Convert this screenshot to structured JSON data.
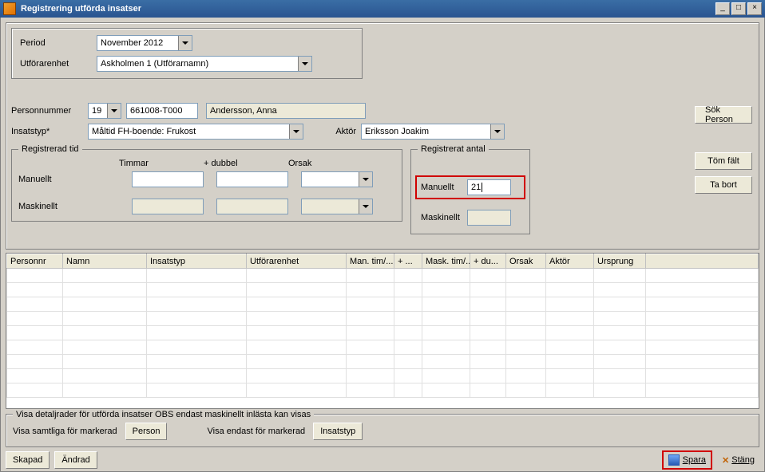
{
  "window": {
    "title": "Registrering utförda insatser"
  },
  "labels": {
    "period": "Period",
    "utforarenhet": "Utförarenhet",
    "personnummer": "Personnummer",
    "insatstyp": "Insatstyp*",
    "aktor": "Aktör",
    "timmar": "Timmar",
    "plus_dubbel": "+ dubbel",
    "orsak": "Orsak",
    "manuellt": "Manuellt",
    "maskinellt": "Maskinellt",
    "reg_tid": "Registrerad tid",
    "reg_antal": "Registrerat antal",
    "visa_samtliga": "Visa samtliga för markerad",
    "visa_endast": "Visa endast för markerad",
    "detail_legend": "Visa detaljrader för utförda insatser OBS endast maskinellt inlästa kan visas"
  },
  "buttons": {
    "sok_person": "Sök Person",
    "tom_falt": "Töm fält",
    "ta_bort": "Ta bort",
    "person": "Person",
    "insatstyp_btn": "Insatstyp",
    "skapad": "Skapad",
    "andrad": "Ändrad",
    "spara": "Spara",
    "stang": "Stäng"
  },
  "fields": {
    "period": "November 2012",
    "utforarenhet": "Askholmen 1 (Utförarnamn)",
    "century": "19",
    "pnr": "661008-T000",
    "person_name": "Andersson, Anna",
    "insatstyp": "Måltid FH-boende: Frukost",
    "aktor": "Eriksson Joakim",
    "manuellt_antal": "21"
  },
  "grid": {
    "headers": [
      "Personnr",
      "Namn",
      "Insatstyp",
      "Utförarenhet",
      "Man. tim/...",
      "+ ...",
      "Mask. tim/...",
      "+ du...",
      "Orsak",
      "Aktör",
      "Ursprung"
    ],
    "widths": [
      70,
      105,
      125,
      125,
      60,
      35,
      60,
      45,
      50,
      60,
      65
    ]
  }
}
